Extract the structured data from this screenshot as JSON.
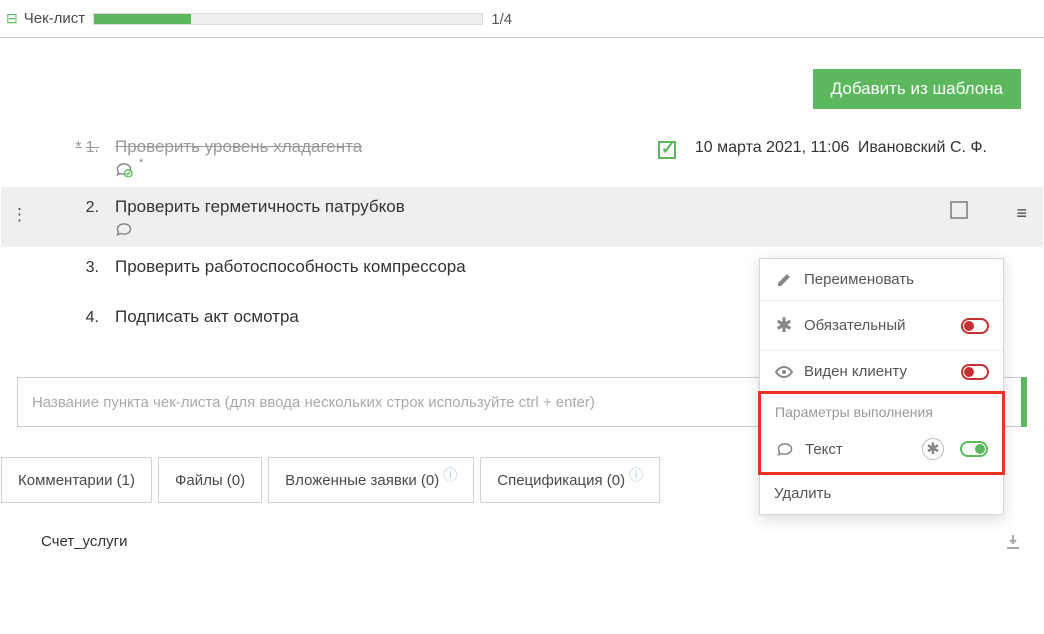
{
  "tab": {
    "title": "Чек-лист",
    "progress": "1/4",
    "progressPercent": 25
  },
  "buttons": {
    "addFromTemplate": "Добавить из шаблона"
  },
  "items": [
    {
      "index": "1.",
      "title": "Проверить уровень хладагента",
      "done": true,
      "required": true,
      "completedAt": "10 марта 2021, 11:06",
      "completedBy": "Ивановский С. Ф.",
      "hasComment": true
    },
    {
      "index": "2.",
      "title": "Проверить герметичность патрубков",
      "done": false,
      "hasComment": true
    },
    {
      "index": "3.",
      "title": "Проверить работоспособность компрессора",
      "done": false
    },
    {
      "index": "4.",
      "title": "Подписать акт осмотра",
      "done": false
    }
  ],
  "inputPlaceholder": "Название пункта чек-листа (для ввода нескольких строк используйте ctrl + enter)",
  "navTabs": {
    "comments": "Комментарии (1)",
    "files": "Файлы (0)",
    "nested": "Вложенные заявки (0)",
    "spec": "Спецификация (0)"
  },
  "account": "Счет_услуги",
  "contextMenu": {
    "rename": "Переименовать",
    "required": "Обязательный",
    "visible": "Виден клиенту",
    "paramsTitle": "Параметры выполнения",
    "text": "Текст",
    "delete": "Удалить"
  }
}
